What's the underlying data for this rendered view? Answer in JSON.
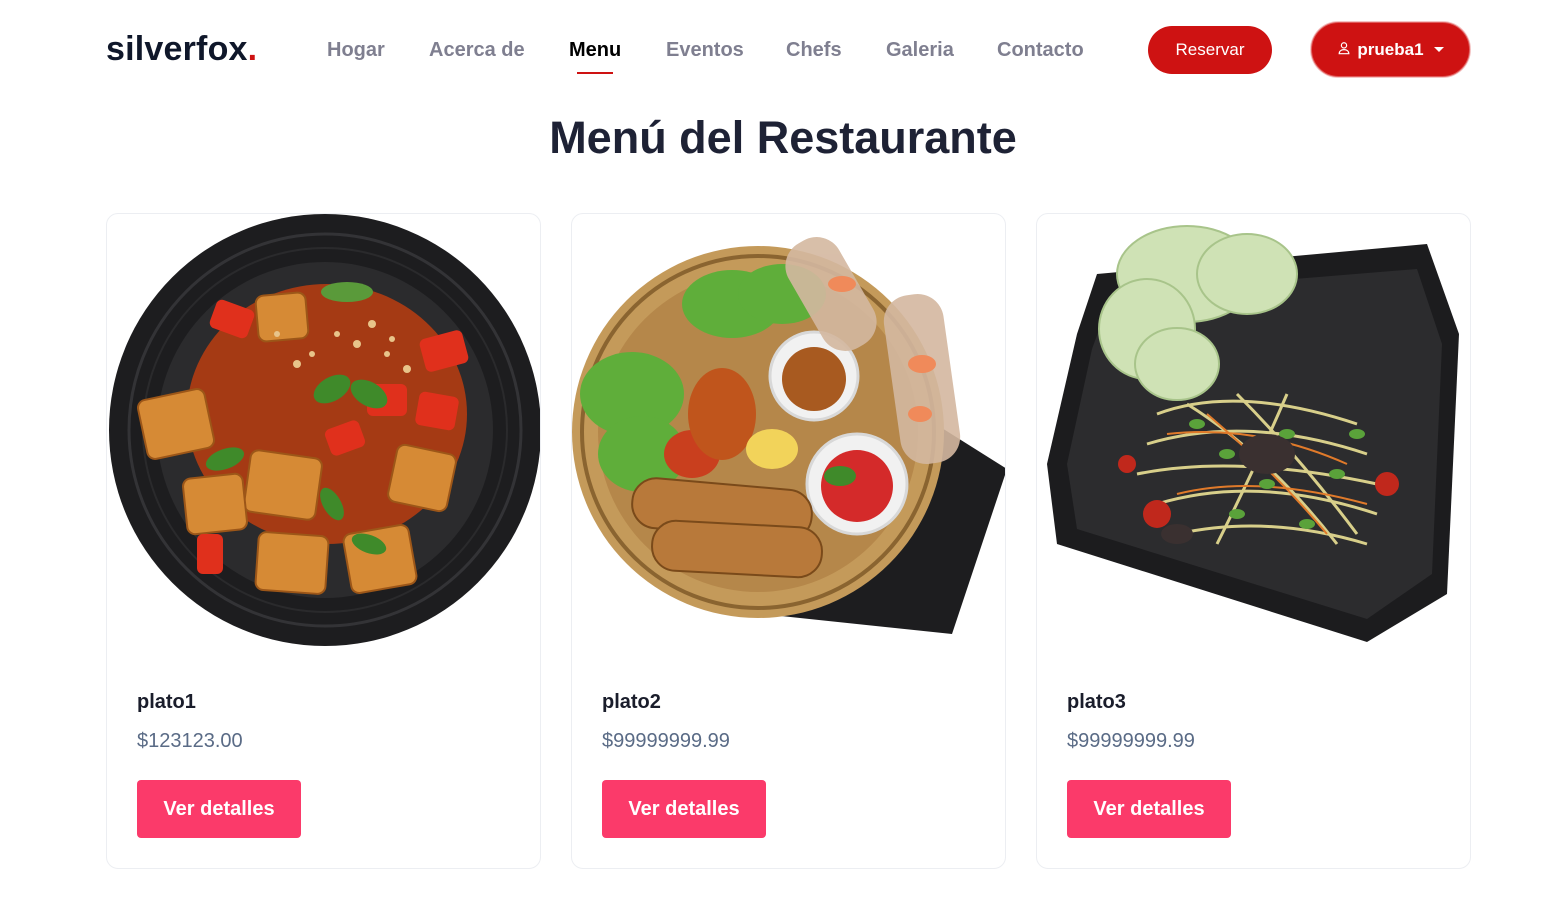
{
  "brand": {
    "name": "silverfox",
    "dot": ".",
    "accent": "#ce1212"
  },
  "nav": {
    "items": [
      {
        "label": "Hogar",
        "active": false
      },
      {
        "label": "Acerca de",
        "active": false
      },
      {
        "label": "Menu",
        "active": true
      },
      {
        "label": "Eventos",
        "active": false
      },
      {
        "label": "Chefs",
        "active": false
      },
      {
        "label": "Galeria",
        "active": false
      },
      {
        "label": "Contacto",
        "active": false
      }
    ]
  },
  "header": {
    "reserve_label": "Reservar",
    "user_label": "prueba1",
    "user_icon": "person-icon",
    "user_caret_icon": "caret-down-icon"
  },
  "page": {
    "title": "Menú del Restaurante"
  },
  "dishes": [
    {
      "name": "plato1",
      "price": "$123123.00",
      "button": "Ver detalles",
      "image": "tofu-stir-fry-dish"
    },
    {
      "name": "plato2",
      "price": "$99999999.99",
      "button": "Ver detalles",
      "image": "spring-rolls-basket-dish"
    },
    {
      "name": "plato3",
      "price": "$99999999.99",
      "button": "Ver detalles",
      "image": "papaya-salad-dish"
    }
  ],
  "colors": {
    "primary_red": "#ce1212",
    "detail_button": "#fb3a6a",
    "price_text": "#5a6b86"
  }
}
